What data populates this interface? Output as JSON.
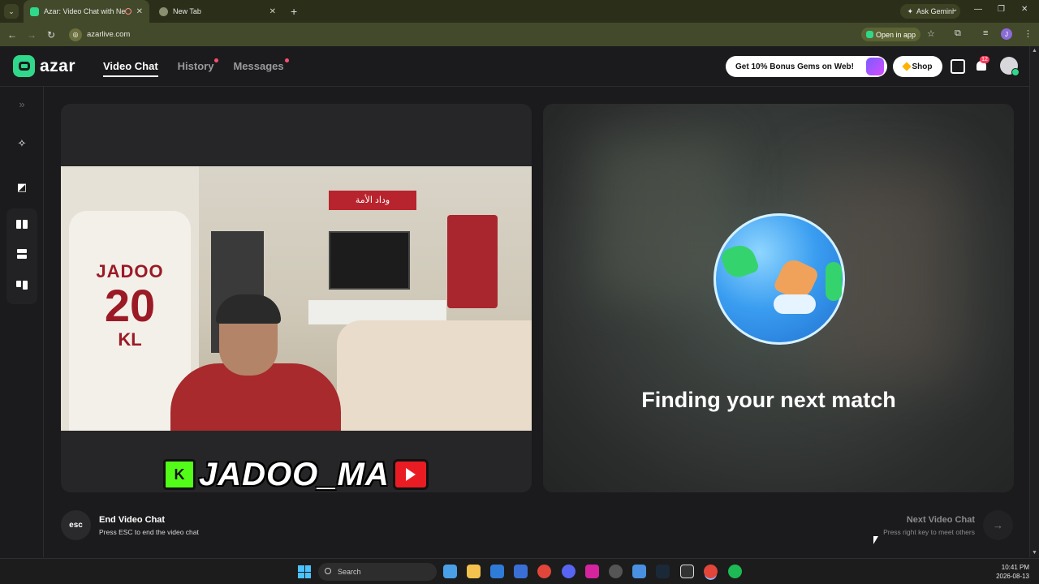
{
  "browser": {
    "tabs": [
      {
        "title": "Azar: Video Chat with New",
        "active": true
      },
      {
        "title": "New Tab",
        "active": false
      }
    ],
    "new_tab_glyph": "+",
    "ask_gemini": "Ask Gemini",
    "url": "azarlive.com",
    "open_in_app": "Open in app",
    "profile_initial": "J"
  },
  "app": {
    "logo_text": "azar",
    "nav": [
      {
        "label": "Video Chat",
        "active": true,
        "dot": false
      },
      {
        "label": "History",
        "active": false,
        "dot": true
      },
      {
        "label": "Messages",
        "active": false,
        "dot": true
      }
    ],
    "promo_label": "Get 10% Bonus Gems on Web!",
    "shop_label": "Shop",
    "notification_count": "12"
  },
  "video": {
    "jersey_name": "JADOO",
    "jersey_number": "20",
    "jersey_initials": "KL",
    "scarf_text": "وداد الأمة",
    "watermark": "JADOO_MA",
    "kick_glyph": "K",
    "status_text": "Finding your next match"
  },
  "controls": {
    "esc_label": "esc",
    "end_title": "End Video Chat",
    "end_subtitle": "Press ESC to end the video chat",
    "next_title": "Next Video Chat",
    "next_subtitle": "Press right key to meet others",
    "next_arrow": "→"
  },
  "taskbar": {
    "search_label": "Search",
    "time": "10:41 PM",
    "date": "2026-08-13"
  },
  "colors": {
    "brand_green": "#2fd88a",
    "nav_dot": "#ff4f6d",
    "chrome_bar": "#2b2f1a",
    "chrome_toolbar": "#434a2b"
  }
}
